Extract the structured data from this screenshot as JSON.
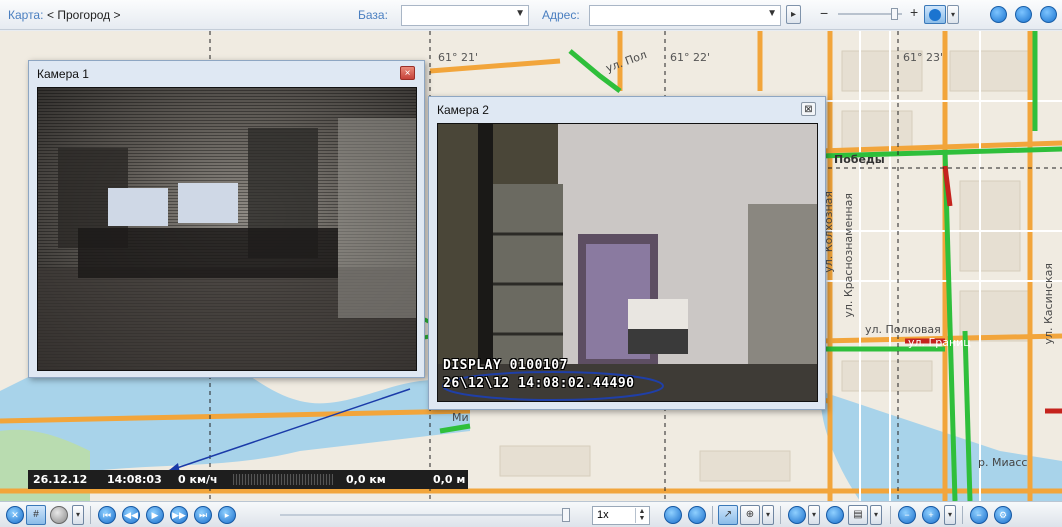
{
  "topbar": {
    "map_label": "Карта:",
    "map_value": "< Прогород >",
    "base_label": "База:",
    "base_value": "",
    "address_label": "Адрес:",
    "address_value": "",
    "zoom_minus": "−",
    "zoom_plus": "+"
  },
  "map": {
    "grid_labels": [
      "61° 21'",
      "61° 22'",
      "61° 23'"
    ],
    "streets": {
      "pobedy": "Победы",
      "krasnoznamennaya": "ул. Краснознаменная",
      "kolkhoznaya": "ул. Колхозная",
      "polkovaya": "ул. Полковая",
      "granitsa": "ул. Границ",
      "kasinskaya": "ул. Касинская",
      "miass": "р. Миасс",
      "mias_short": "Ми",
      "top_street": "ул. Пол"
    }
  },
  "cameras": [
    {
      "title": "Камера 1",
      "close": "×"
    },
    {
      "title": "Камера 2",
      "close": "⊠",
      "osd_line1": "DISPLAY 0100107",
      "osd_line2": "26\\12\\12 14:08:02.44490"
    }
  ],
  "status": {
    "date": "26.12.12",
    "time": "14:08:03",
    "speed": "0 км/ч",
    "distance_km": "0,0 км",
    "distance_m": "0,0 м"
  },
  "bottombar": {
    "speed_value": "1x"
  },
  "colors": {
    "road_orange": "#f2a53b",
    "road_green": "#2fbf3b",
    "road_red": "#c5231d",
    "water": "#a8d3ea",
    "accent": "#1b74d0"
  }
}
